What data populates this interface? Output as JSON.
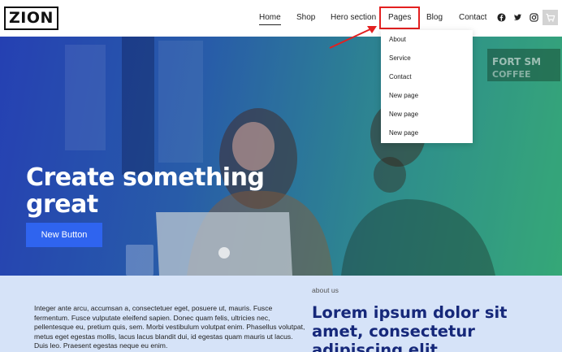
{
  "brand": {
    "logo_text": "ZION"
  },
  "nav": {
    "items": [
      "Home",
      "Shop",
      "Hero section",
      "Pages",
      "Blog",
      "Contact"
    ],
    "active": "Home",
    "social_icons": [
      "facebook-icon",
      "twitter-icon",
      "instagram-icon"
    ],
    "cart_icon": "cart-icon"
  },
  "dropdown": {
    "items": [
      "About",
      "Service",
      "Contact",
      "New page",
      "New page",
      "New page"
    ]
  },
  "hero": {
    "title": "Create something great",
    "button_label": "New Button",
    "gradient_colors": [
      "#2b49c9",
      "#3fc781"
    ]
  },
  "lower": {
    "body_text": "Integer ante arcu, accumsan a, consectetuer eget, posuere ut, mauris. Fusce fermentum. Fusce vulputate eleifend sapien. Donec quam felis, ultricies nec, pellentesque eu, pretium quis, sem. Morbi vestibulum volutpat enim. Phasellus volutpat, metus eget egestas mollis, lacus lacus blandit dui, id egestas quam mauris ut lacus. Duis leo. Praesent egestas neque eu enim.",
    "label": "about us",
    "heading": "Lorem ipsum dolor sit amet, consectetur adipiscing elit"
  },
  "colors": {
    "accent_button": "#2f64ef",
    "heading_navy": "#16287a",
    "annotation_red": "#e32020",
    "lower_bg": "#d6e3f8"
  }
}
